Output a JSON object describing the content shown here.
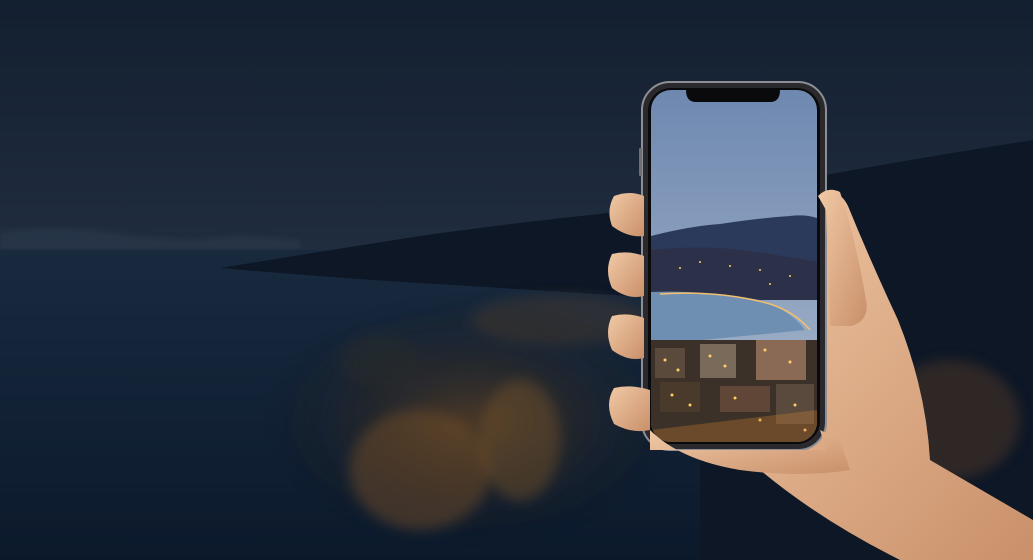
{
  "scene": {
    "subject": "hand-holding-smartphone",
    "colors": {
      "sky_top": "#1b2a3c",
      "sky_bottom": "#2c3b4d",
      "water": "#142a44",
      "hills": "#0f1a2a",
      "city_lights": "#c8782a",
      "phone_frame": "#1a1a1e",
      "phone_sky": "#7f9fc4",
      "skin": "#e3b48f"
    }
  }
}
